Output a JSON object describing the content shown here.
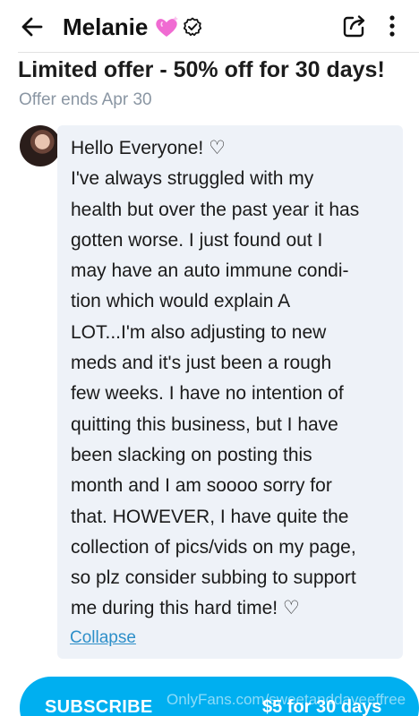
{
  "header": {
    "title": "Melanie",
    "icons": [
      "back-arrow-icon",
      "sparkling-heart-icon",
      "verified-badge-icon",
      "share-icon",
      "more-vertical-icon"
    ]
  },
  "offer": {
    "title": "Limited offer - 50% off for 30 days!",
    "subtitle": "Offer ends Apr 30"
  },
  "message": {
    "text": "Hello Everyone! ♡\nI've always struggled with my\nhealth but over the past year it has\ngotten worse. I just found out I\nmay have an auto immune condi-\ntion which would explain A\nLOT...I'm also adjusting to new\nmeds and it's just been a rough\nfew weeks. I have no intention of\nquitting this business, but I have\nbeen slacking on posting this\nmonth and I am soooo sorry for\nthat. HOWEVER, I have quite the\ncollection of pics/vids on my page,\nso plz consider subbing to support\nme during this hard time! ♡",
    "collapse_label": "Collapse"
  },
  "subscribe": {
    "label": "SUBSCRIBE",
    "price": "$5 for 30 days",
    "watermark": "OnlyFans.com/sweetanddaveeffree"
  },
  "colors": {
    "accent": "#00aff0",
    "link": "#2d8fc9",
    "bubble": "#eef2f8",
    "muted": "#8a96a3",
    "heart": "#f06bd2"
  }
}
